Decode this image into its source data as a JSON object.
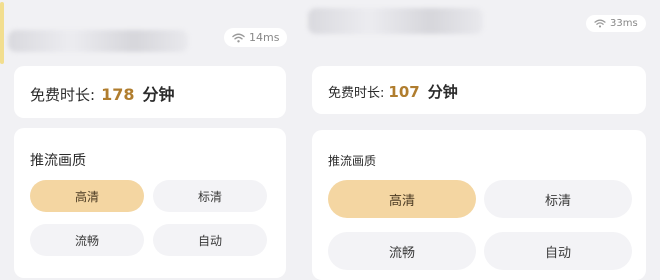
{
  "colors": {
    "accent_text": "#b07d2e",
    "selected_option_bg": "#f4d6a2",
    "option_bg": "#f3f3f6",
    "page_bg": "#f1f1f4"
  },
  "left": {
    "ping": "14ms",
    "free_time": {
      "label": "免费时长:",
      "value": "178",
      "unit": "分钟"
    },
    "quality": {
      "title": "推流画质",
      "options": [
        "高清",
        "标清",
        "流畅",
        "自动"
      ],
      "selected": "高清"
    }
  },
  "right": {
    "ping": "33ms",
    "free_time": {
      "label": "免费时长:",
      "value": "107",
      "unit": "分钟"
    },
    "quality": {
      "title": "推流画质",
      "options": [
        "高清",
        "标清",
        "流畅",
        "自动"
      ],
      "selected": "高清"
    }
  },
  "icons": {
    "ping": "wifi-icon"
  }
}
